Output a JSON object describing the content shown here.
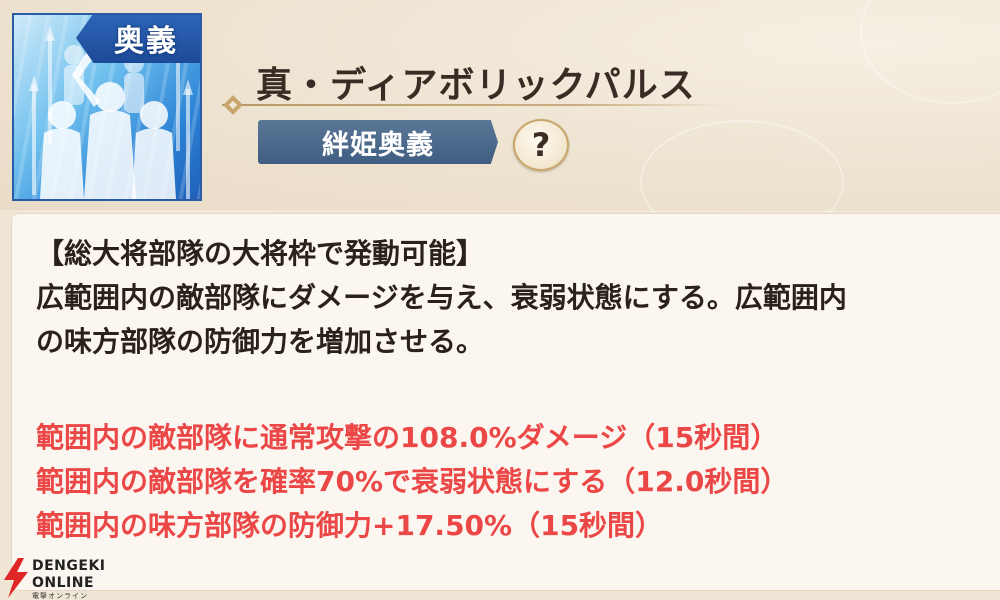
{
  "skill": {
    "category_tab": "奥義",
    "title": "真・ディアボリックパルス",
    "type_badge": "絆姫奥義",
    "help_symbol": "?"
  },
  "description": {
    "lines": [
      "【総大将部隊の大将枠で発動可能】",
      "広範囲内の敵部隊にダメージを与え、衰弱状態にする。広範囲内",
      "の味方部隊の防御力を増加させる。"
    ]
  },
  "effects": [
    "範囲内の敵部隊に通常攻撃の108.0%ダメージ（15秒間）",
    "範囲内の敵部隊を確率70%で衰弱状態にする（12.0秒間）",
    "範囲内の味方部隊の防御力+17.50%（15秒間）"
  ],
  "watermark": {
    "line1": "DENGEKI",
    "line2": "ONLINE",
    "line3": "電撃オンライン"
  },
  "colors": {
    "effect_text": "#ec4747",
    "badge": "#4a6a8e",
    "icon_tab": "#1f52a3"
  }
}
